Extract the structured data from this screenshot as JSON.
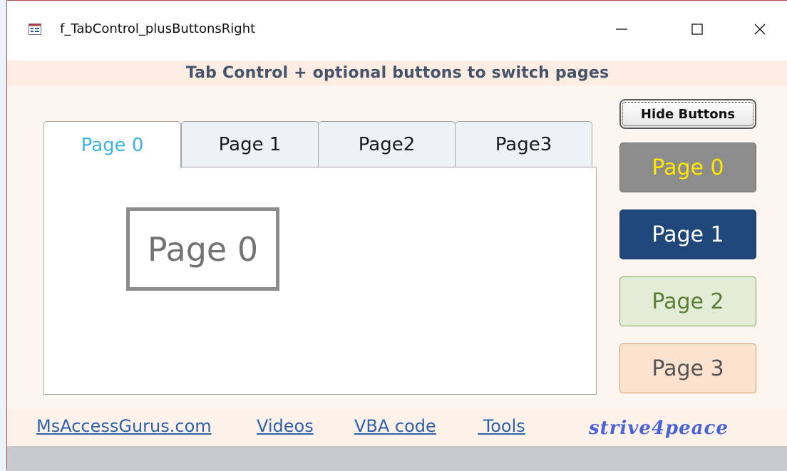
{
  "window": {
    "title": "f_TabControl_plusButtonsRight"
  },
  "header": {
    "text": "Tab Control + optional buttons to switch pages"
  },
  "tabs": [
    {
      "label": "Page 0",
      "active": true
    },
    {
      "label": "Page 1",
      "active": false
    },
    {
      "label": "Page2",
      "active": false
    },
    {
      "label": "Page3",
      "active": false
    }
  ],
  "tab_page": {
    "label": "Page 0"
  },
  "buttons": {
    "hide": "Hide Buttons",
    "page0": "Page 0",
    "page1": "Page 1",
    "page2": "Page 2",
    "page3": "Page 3"
  },
  "footer": {
    "links": [
      "MsAccessGurus.com",
      "Videos",
      "VBA code",
      " Tools"
    ],
    "brand": "strive4peace"
  },
  "colors": {
    "active_tab_text": "#3cb4e7",
    "page0_bg": "#8c8c8c",
    "page0_text": "#ffe600",
    "page1_bg": "#1f477a",
    "page1_text": "#ffffff",
    "page2_bg": "#e3ecd6",
    "page2_text": "#5a7f35",
    "page3_bg": "#fbe3cf",
    "page3_text": "#555555",
    "link": "#2e62a8",
    "brand": "#4a62d8"
  }
}
